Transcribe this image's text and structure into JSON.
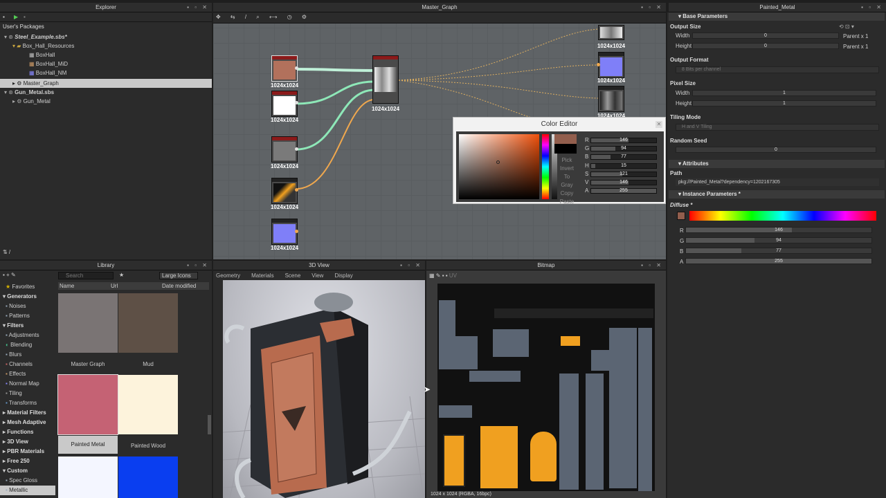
{
  "explorer": {
    "title": "Explorer",
    "root": "User's Packages",
    "items": [
      "Steel_Example.sbs*",
      "Box_Hall_Resources",
      "BoxHall",
      "BoxHall_MiD",
      "BoxHall_NM",
      "Master_Graph",
      "Gun_Metal.sbs",
      "Gun_Metal"
    ]
  },
  "graph": {
    "title": "Master_Graph",
    "nodes": [
      "1024x1024",
      "1024x1024",
      "1024x1024",
      "1024x1024",
      "1024x1024",
      "1024x1024",
      "1024x1024",
      "1024x1024",
      "1024x1024",
      "1024x1024"
    ],
    "footer": "⇅  /"
  },
  "color_editor": {
    "title": "Color Editor",
    "channels": [
      {
        "k": "R",
        "v": "146"
      },
      {
        "k": "G",
        "v": "94"
      },
      {
        "k": "B",
        "v": "77"
      },
      {
        "k": "H",
        "v": "15"
      },
      {
        "k": "S",
        "v": "121"
      },
      {
        "k": "V",
        "v": "146"
      },
      {
        "k": "A",
        "v": "255"
      }
    ],
    "actions": [
      "Pick",
      "Invert",
      "To Gray",
      "Copy",
      "Paste"
    ],
    "current": "#925e4d"
  },
  "library": {
    "title": "Library",
    "search_placeholder": "Search",
    "view_mode": "Large Icons",
    "cols": [
      "Name",
      "Url",
      "Date modified"
    ],
    "categories": [
      {
        "l": "Favorites",
        "b": false
      },
      {
        "l": "Generators",
        "b": true
      },
      {
        "l": "Noises",
        "b": false
      },
      {
        "l": "Patterns",
        "b": false
      },
      {
        "l": "Filters",
        "b": true
      },
      {
        "l": "Adjustments",
        "b": false
      },
      {
        "l": "Blending",
        "b": false
      },
      {
        "l": "Blurs",
        "b": false
      },
      {
        "l": "Channels",
        "b": false
      },
      {
        "l": "Effects",
        "b": false
      },
      {
        "l": "Normal Map",
        "b": false
      },
      {
        "l": "Tiling",
        "b": false
      },
      {
        "l": "Transforms",
        "b": false
      },
      {
        "l": "Material Filters",
        "b": true
      },
      {
        "l": "Mesh Adaptive",
        "b": true
      },
      {
        "l": "Functions",
        "b": true
      },
      {
        "l": "3D View",
        "b": true
      },
      {
        "l": "PBR Materials",
        "b": true
      },
      {
        "l": "Free 250",
        "b": true
      },
      {
        "l": "Custom",
        "b": true
      },
      {
        "l": "Spec Gloss",
        "b": false
      },
      {
        "l": "Metallic",
        "b": false
      }
    ],
    "thumbs": [
      {
        "label": "Master Graph",
        "color": "#7a7474"
      },
      {
        "label": "Mud",
        "color": "#5e5046"
      },
      {
        "label": "Painted Metal",
        "color": "#c56274"
      },
      {
        "label": "Painted Wood",
        "color": "#fdf3dc"
      },
      {
        "label": "",
        "color": "#f4f6ff"
      },
      {
        "label": "",
        "color": "#0a3ef0"
      }
    ]
  },
  "view3d": {
    "title": "3D View",
    "menus": [
      "Geometry",
      "Materials",
      "Scene",
      "View",
      "Display"
    ]
  },
  "bitmap": {
    "title": "Bitmap",
    "status": "1024 x 1024 (RGBA, 16bpc)",
    "uv": "UV"
  },
  "props": {
    "title": "Painted_Metal",
    "base": "Base Parameters",
    "output_size": "Output Size",
    "width": "Width",
    "height": "Height",
    "parent1": "Parent x 1",
    "zero": "0",
    "output_format": "Output Format",
    "format_val": "8 Bits per channel",
    "pixel_size": "Pixel Size",
    "one": "1",
    "tiling_mode": "Tiling Mode",
    "tiling_val": "H and V Tiling",
    "random_seed": "Random Seed",
    "attributes": "Attributes",
    "path": "Path",
    "path_val": "pkg://Painted_Metal?dependency=1202167305",
    "instance": "Instance Parameters *",
    "diffuse": "Diffuse *",
    "rgba": [
      {
        "k": "R",
        "v": "146",
        "f": 0.57
      },
      {
        "k": "G",
        "v": "94",
        "f": 0.37
      },
      {
        "k": "B",
        "v": "77",
        "f": 0.3
      },
      {
        "k": "A",
        "v": "255",
        "f": 1
      }
    ]
  }
}
